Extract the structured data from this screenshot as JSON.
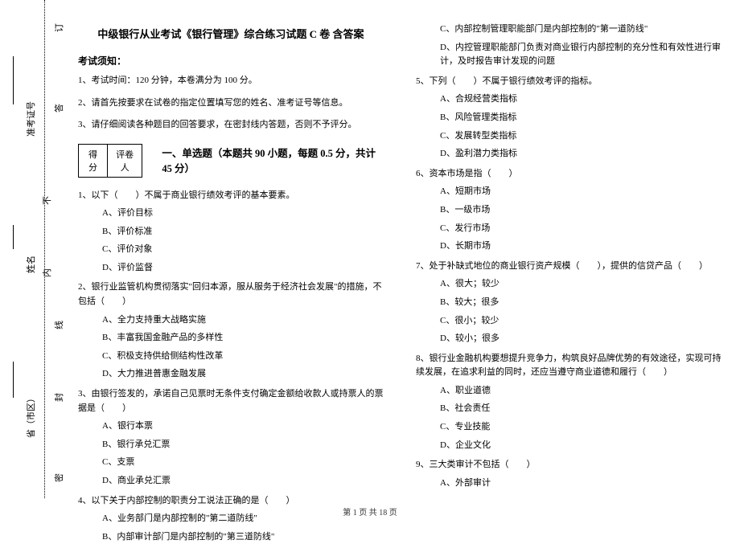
{
  "binding": {
    "char1": "订",
    "char2": "答",
    "char3": "线",
    "char4": "封",
    "char5": "密",
    "inner1": "不",
    "inner2": "内"
  },
  "side": {
    "id_label": "准考证号",
    "name_label": "姓名",
    "province_label": "省（市区）"
  },
  "header": {
    "title": "中级银行从业考试《银行管理》综合练习试题 C 卷 含答案"
  },
  "notice": {
    "head": "考试须知：",
    "n1": "1、考试时间：120 分钟，本卷满分为 100 分。",
    "n2": "2、请首先按要求在试卷的指定位置填写您的姓名、准考证号等信息。",
    "n3": "3、请仔细阅读各种题目的回答要求，在密封线内答题，否则不予评分。"
  },
  "scorebox": {
    "c1": "得分",
    "c2": "评卷人"
  },
  "section1": {
    "title": "一、单选题（本题共 90 小题，每题 0.5 分，共计 45 分）"
  },
  "q1": {
    "stem": "1、以下（　　）不属于商业银行绩效考评的基本要素。",
    "a": "A、评价目标",
    "b": "B、评价标准",
    "c": "C、评价对象",
    "d": "D、评价监督"
  },
  "q2": {
    "stem": "2、银行业监管机构贯彻落实\"回归本源，服从服务于经济社会发展\"的措施，不包括（　　）",
    "a": "A、全力支持重大战略实施",
    "b": "B、丰富我国金融产品的多样性",
    "c": "C、积极支持供给侧结构性改革",
    "d": "D、大力推进普惠金融发展"
  },
  "q3": {
    "stem": "3、由银行签发的，承诺自己见票时无条件支付确定金额给收款人或持票人的票据是（　　）",
    "a": "A、银行本票",
    "b": "B、银行承兑汇票",
    "c": "C、支票",
    "d": "D、商业承兑汇票"
  },
  "q4": {
    "stem": "4、以下关于内部控制的职责分工说法正确的是（　　）",
    "a": "A、业务部门是内部控制的\"第二道防线\"",
    "b": "B、内部审计部门是内部控制的\"第三道防线\"",
    "c": "C、内部控制管理职能部门是内部控制的\"第一道防线\"",
    "d": "D、内控管理职能部门负责对商业银行内部控制的充分性和有效性进行审计，及时报告审计发现的问题"
  },
  "q5": {
    "stem": "5、下列（　　）不属于银行绩效考评的指标。",
    "a": "A、合规经营类指标",
    "b": "B、风险管理类指标",
    "c": "C、发展转型类指标",
    "d": "D、盈利潜力类指标"
  },
  "q6": {
    "stem": "6、资本市场是指（　　）",
    "a": "A、短期市场",
    "b": "B、一级市场",
    "c": "C、发行市场",
    "d": "D、长期市场"
  },
  "q7": {
    "stem": "7、处于补缺式地位的商业银行资产规模（　　），提供的信贷产品（　　）",
    "a": "A、很大；较少",
    "b": "B、较大；很多",
    "c": "C、很小；较少",
    "d": "D、较小；很多"
  },
  "q8": {
    "stem": "8、银行业金融机构要想提升竞争力，构筑良好品牌优势的有效途径，实现可持续发展，在追求利益的同时，还应当遵守商业道德和履行（　　）",
    "a": "A、职业道德",
    "b": "B、社会责任",
    "c": "C、专业技能",
    "d": "D、企业文化"
  },
  "q9": {
    "stem": "9、三大类审计不包括（　　）",
    "a": "A、外部审计"
  },
  "footer": {
    "text": "第 1 页 共 18 页"
  }
}
